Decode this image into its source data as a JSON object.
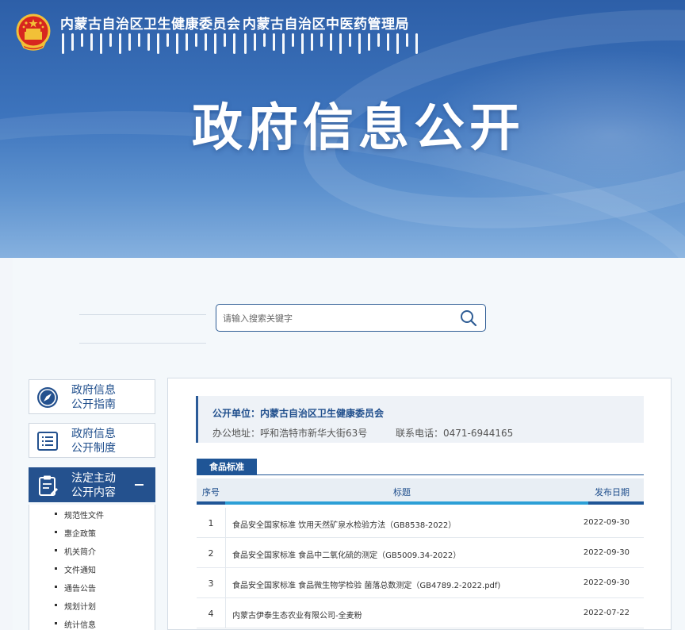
{
  "header": {
    "org1": "内蒙古自治区卫生健康委员会",
    "org2": "内蒙古自治区中医药管理局",
    "title": "政府信息公开"
  },
  "search": {
    "placeholder": "请输入搜索关键字"
  },
  "nav": {
    "items": [
      {
        "line1": "政府信息",
        "line2": "公开指南",
        "icon": "compass-icon"
      },
      {
        "line1": "政府信息",
        "line2": "公开制度",
        "icon": "document-list-icon"
      },
      {
        "line1": "法定主动",
        "line2": "公开内容",
        "icon": "clipboard-edit-icon"
      }
    ],
    "sub_items": [
      "规范性文件",
      "惠企政策",
      "机关简介",
      "文件通知",
      "通告公告",
      "规划计划",
      "统计信息"
    ]
  },
  "unit": {
    "name_label": "公开单位：内蒙古自治区卫生健康委员会",
    "address": "办公地址：呼和浩特市新华大街63号",
    "phone": "联系电话：0471-6944165"
  },
  "section": {
    "tab_label": "食品标准"
  },
  "table": {
    "headers": {
      "num": "序号",
      "title": "标题",
      "date": "发布日期"
    },
    "rows": [
      {
        "num": "1",
        "title": "食品安全国家标准 饮用天然矿泉水检验方法（GB8538-2022）",
        "date": "2022-09-30"
      },
      {
        "num": "2",
        "title": "食品安全国家标准 食品中二氧化硫的测定（GB5009.34-2022）",
        "date": "2022-09-30"
      },
      {
        "num": "3",
        "title": "食品安全国家标准 食品微生物学检验 菌落总数测定（GB4789.2-2022.pdf)",
        "date": "2022-09-30"
      },
      {
        "num": "4",
        "title": "内蒙古伊泰生态农业有限公司-全麦粉",
        "date": "2022-07-22"
      }
    ]
  },
  "colors": {
    "primary": "#1f5596",
    "accent": "#2c9fd6",
    "banner": "#3d74bd"
  }
}
